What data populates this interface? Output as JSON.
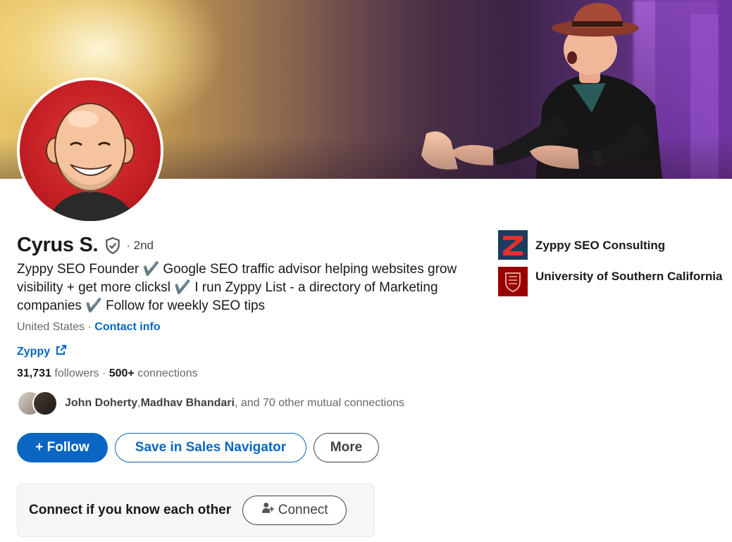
{
  "profile": {
    "name": "Cyrus S.",
    "degree": "· 2nd",
    "headline": "Zyppy SEO Founder ✔️ Google SEO traffic advisor helping websites grow visibility + get more clicksl ✔️ I run Zyppy List - a directory of Marketing companies ✔️ Follow for weekly SEO tips",
    "location": "United States",
    "location_separator": " · ",
    "contact_info": "Contact info",
    "website": "Zyppy",
    "followers_count": "31,731",
    "followers_label": " followers",
    "connections_sep": "  · ",
    "connections_count": "500+",
    "connections_label": " connections",
    "mutual_name_1": "John Doherty",
    "mutual_sep": ", ",
    "mutual_name_2": "Madhav Bhandari",
    "mutual_rest": ", and 70 other mutual connections"
  },
  "actions": {
    "follow_label": "+ Follow",
    "sales_nav_label": "Save in Sales Navigator",
    "more_label": "More"
  },
  "connect_card": {
    "text": "Connect if you know each other",
    "button_label": "Connect"
  },
  "sidebar": {
    "experience": "Zyppy SEO Consulting",
    "education": "University of Southern California"
  },
  "colors": {
    "brand_blue": "#0a66c2",
    "usc_cardinal": "#990000",
    "zyppy_red": "#e0322c",
    "zyppy_navy": "#1e3a5f"
  },
  "icons": [
    "verified-shield-icon",
    "external-link-icon",
    "add-person-icon"
  ]
}
